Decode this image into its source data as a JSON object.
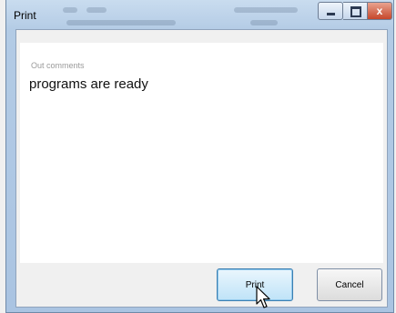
{
  "window": {
    "title": "Print",
    "controls": {
      "minimize": "minimize",
      "maximize": "maximize",
      "close": "x"
    }
  },
  "comments": {
    "caption": "Out comments",
    "text": "programs are ready"
  },
  "buttons": {
    "print_label": "Print",
    "cancel_label": "Cancel"
  },
  "colors": {
    "frame": "#b3cbe5",
    "close_button": "#c6472b",
    "focused_button_border": "#3c7fb1"
  }
}
